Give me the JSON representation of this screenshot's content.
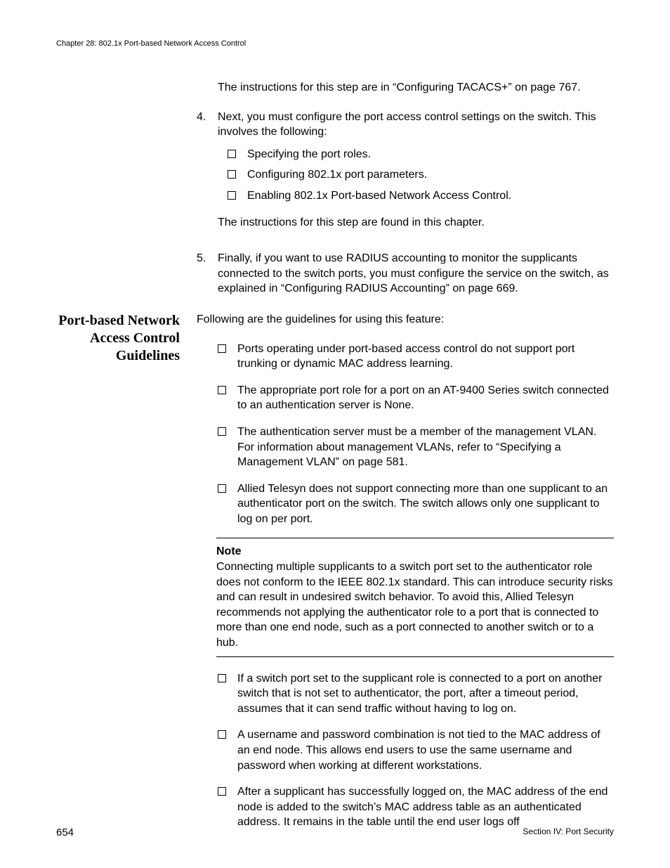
{
  "header": "Chapter 28: 802.1x Port-based Network Access Control",
  "intro_para": "The instructions for this step are in “Configuring TACACS+” on page 767.",
  "step4": {
    "num": "4.",
    "lead": "Next, you must configure the port access control settings on the switch. This involves the following:",
    "bullets": [
      "Specifying the port roles.",
      "Configuring 802.1x port parameters.",
      "Enabling 802.1x Port-based Network Access Control."
    ],
    "trail": "The instructions for this step are found in this chapter."
  },
  "step5": {
    "num": "5.",
    "body": "Finally, if you want to use RADIUS accounting to monitor the supplicants connected to the switch ports, you must configure the service on the switch, as explained in “Configuring RADIUS Accounting” on page 669."
  },
  "side_heading": "Port-based Network Access Control Guidelines",
  "guidelines_intro": "Following are the guidelines for using this feature:",
  "guidelines_pre_note": [
    "Ports operating under port-based access control do not support port trunking or dynamic MAC address learning.",
    "The appropriate port role for a port on an AT-9400 Series switch connected to an authentication server is None.",
    "The authentication server must be a member of the management VLAN. For information about management VLANs, refer to “Specifying a Management VLAN” on page 581.",
    "Allied Telesyn does not support connecting more than one supplicant to an authenticator port on the switch. The switch allows only one supplicant to log on per port."
  ],
  "note": {
    "title": "Note",
    "body": "Connecting multiple supplicants to a switch port set to the authenticator role does not conform to the IEEE 802.1x standard. This can introduce security risks and can result in undesired switch behavior. To avoid this, Allied Telesyn recommends not applying the authenticator role to a port that is connected to more than one end node, such as a port connected to another switch or to a hub."
  },
  "guidelines_post_note": [
    "If a switch port set to the supplicant role is connected to a port on another switch that is not set to authenticator, the port, after a timeout period, assumes that it can send traffic without having to log on.",
    "A username and password combination is not tied to the MAC address of an end node. This allows end users to use the same username and password when working at different workstations.",
    "After a supplicant has successfully logged on, the MAC address of the end node is added to the switch’s MAC address table as an authenticated address. It remains in the table until the end user logs off"
  ],
  "footer": {
    "page": "654",
    "section": "Section IV: Port Security"
  }
}
